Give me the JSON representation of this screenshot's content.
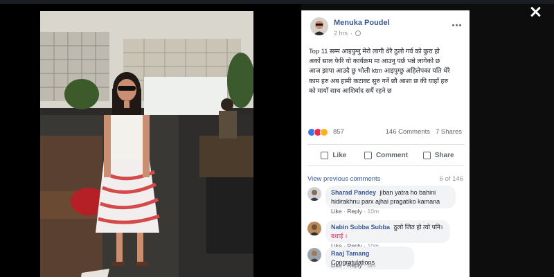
{
  "viewer": {
    "close_icon": "close-icon"
  },
  "post": {
    "author": "Menuka Poudel",
    "time": "2 hrs",
    "privacy_icon": "globe-icon",
    "text_lines": [
      "Top 11 सम्म आइपुग्नु मेरो लागी धेरै ठुलो गर्व को कुरा हो",
      "अर्को साल फेरि यो कार्यक्रम मा आउनु पर्छ भन्ने लागेको छ",
      "आज झापा आउदै छु भोली ktm आइपुग्छु अहिलेपका यति धेरै",
      "काम हरु अब हामी कटाक्ट सुरु गर्ने छौ आशा छ की याहाँ हरु",
      "को मायाँ साथ आशिर्वाद सधैं रहने छ"
    ],
    "reactions_count": "857",
    "comments_count": "146 Comments",
    "shares_count": "7 Shares"
  },
  "actions": {
    "like": "Like",
    "comment": "Comment",
    "share": "Share"
  },
  "comments_section": {
    "view_previous": "View previous comments",
    "counter": "6 of 146",
    "items": [
      {
        "name": "Sharad Pandey",
        "text_line1": "jiban yatra ho bahini",
        "text_line2": "hidirakhnu parx ajhai pragatiko kamana",
        "like": "Like",
        "reply": "Reply",
        "sep": "·",
        "time": "10m"
      },
      {
        "name": "Nabin Subba Subba",
        "text_line1": "ठुलो जित हो त्यो पनि।",
        "text_line2": "बधाई ।",
        "like": "Like",
        "reply": "Reply",
        "sep": "·",
        "time": "10m"
      },
      {
        "name": "Raaj Tamang",
        "text_line1": "Congratulations",
        "like": "Like",
        "reply": "Reply",
        "sep": "·",
        "time": "6m"
      }
    ]
  },
  "colors": {
    "fb_blue": "#385898",
    "name_blue": "#365899",
    "bubble": "#f2f3f5",
    "red": "#e0245e"
  }
}
